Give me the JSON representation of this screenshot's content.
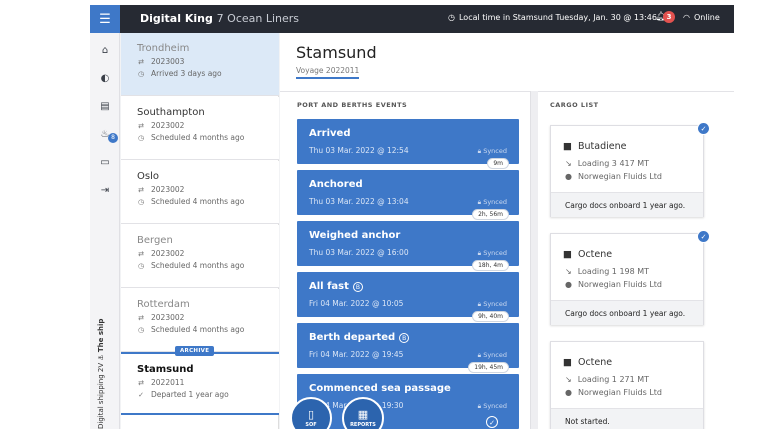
{
  "header": {
    "brand": "Digital King",
    "brand_sub": "7 Ocean Liners",
    "clock_icon": "clock-icon",
    "local_time": "Local time in Stamsund Tuesday, Jan. 30 @ 13:46",
    "notification_count": "3",
    "status": "Online"
  },
  "sidebar": {
    "badge_count": "8",
    "vertical_label": "Digital shipping 2V",
    "section_label": "The ship",
    "icons": [
      "home-icon",
      "dashboard-icon",
      "clipboard-icon",
      "fire-icon",
      "chat-icon",
      "logout-icon"
    ]
  },
  "voyages": [
    {
      "port": "Trondheim",
      "number": "2023003",
      "status": "Arrived 3 days ago"
    },
    {
      "port": "Southampton",
      "number": "2023002",
      "status": "Scheduled 4 months ago"
    },
    {
      "port": "Oslo",
      "number": "2023002",
      "status": "Scheduled 4 months ago"
    },
    {
      "port": "Bergen",
      "number": "2023002",
      "status": "Scheduled 4 months ago"
    },
    {
      "port": "Rotterdam",
      "number": "2023002",
      "status": "Scheduled 4 months ago"
    },
    {
      "port": "Stamsund",
      "number": "2022011",
      "status": "Departed 1 year ago",
      "tag": "ARCHIVE"
    }
  ],
  "main": {
    "title": "Stamsund",
    "voyage": "Voyage 2022011",
    "events_title": "PORT AND BERTHS EVENTS",
    "cargo_title": "CARGO LIST"
  },
  "events": [
    {
      "name": "Arrived",
      "date": "Thu 03 Mar. 2022 @ 12:54",
      "sync": "Synced",
      "duration": "9m",
      "badge": ""
    },
    {
      "name": "Anchored",
      "date": "Thu 03 Mar. 2022 @ 13:04",
      "sync": "Synced",
      "duration": "2h, 56m",
      "badge": ""
    },
    {
      "name": "Weighed anchor",
      "date": "Thu 03 Mar. 2022 @ 16:00",
      "sync": "Synced",
      "duration": "18h, 4m",
      "badge": ""
    },
    {
      "name": "All fast",
      "date": "Fri 04 Mar. 2022 @ 10:05",
      "sync": "Synced",
      "duration": "9h, 40m",
      "badge": "B"
    },
    {
      "name": "Berth departed",
      "date": "Fri 04 Mar. 2022 @ 19:45",
      "sync": "Synced",
      "duration": "19h, 45m",
      "badge": "B"
    },
    {
      "name": "Commenced sea passage",
      "date": "Fri 04 Mar. 2022 @ 19:30",
      "sync": "Synced",
      "duration": "",
      "badge": ""
    }
  ],
  "fabs": [
    {
      "label": "SOF"
    },
    {
      "label": "REPORTS"
    }
  ],
  "cargo": [
    {
      "name": "Butadiene",
      "loading": "Loading 3 417 MT",
      "company": "Norwegian Fluids Ltd",
      "status": "Cargo docs onboard 1 year ago.",
      "checked": true
    },
    {
      "name": "Octene",
      "loading": "Loading 1 198 MT",
      "company": "Norwegian Fluids Ltd",
      "status": "Cargo docs onboard 1 year ago.",
      "checked": true
    },
    {
      "name": "Octene",
      "loading": "Loading 1 271 MT",
      "company": "Norwegian Fluids Ltd",
      "status": "Not started.",
      "checked": false
    }
  ],
  "colors": {
    "accent": "#3e78c8",
    "topbar": "#262a33",
    "alert": "#e3524f"
  }
}
